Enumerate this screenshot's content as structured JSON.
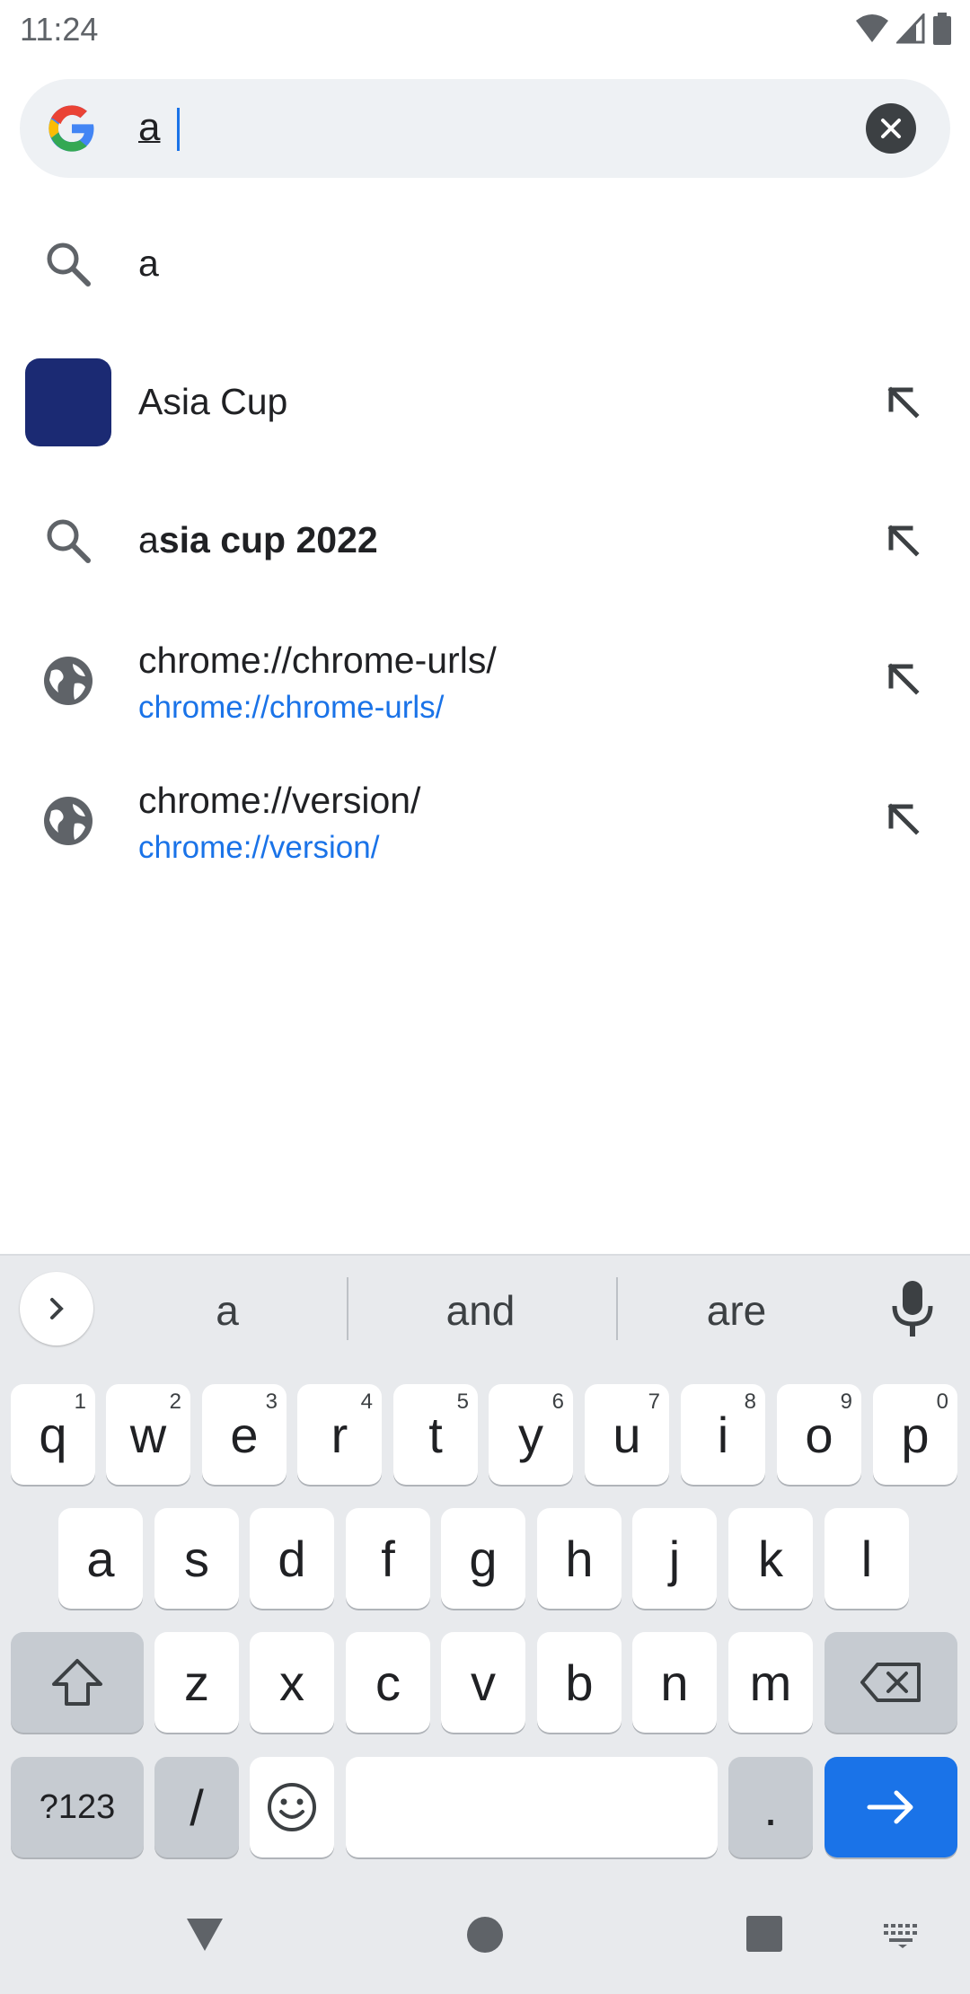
{
  "status": {
    "time": "11:24"
  },
  "omnibox": {
    "query": "a"
  },
  "suggestions": [
    {
      "type": "search",
      "text": "a"
    },
    {
      "type": "entity",
      "text": "Asia Cup"
    },
    {
      "type": "search",
      "prefix": "a",
      "rest": "sia cup 2022"
    },
    {
      "type": "url",
      "title": "chrome://chrome-urls/",
      "url": "chrome://chrome-urls/"
    },
    {
      "type": "url",
      "title": "chrome://version/",
      "url": "chrome://version/"
    }
  ],
  "keyboard": {
    "word_suggestions": [
      "a",
      "and",
      "are"
    ],
    "row1": [
      {
        "k": "q",
        "n": "1"
      },
      {
        "k": "w",
        "n": "2"
      },
      {
        "k": "e",
        "n": "3"
      },
      {
        "k": "r",
        "n": "4"
      },
      {
        "k": "t",
        "n": "5"
      },
      {
        "k": "y",
        "n": "6"
      },
      {
        "k": "u",
        "n": "7"
      },
      {
        "k": "i",
        "n": "8"
      },
      {
        "k": "o",
        "n": "9"
      },
      {
        "k": "p",
        "n": "0"
      }
    ],
    "row2": [
      "a",
      "s",
      "d",
      "f",
      "g",
      "h",
      "j",
      "k",
      "l"
    ],
    "row3": [
      "z",
      "x",
      "c",
      "v",
      "b",
      "n",
      "m"
    ],
    "symbols_label": "?123",
    "slash_label": "/",
    "period_label": "."
  },
  "colors": {
    "accent": "#1a73e8",
    "entity_thumb": "#1b2a73"
  }
}
